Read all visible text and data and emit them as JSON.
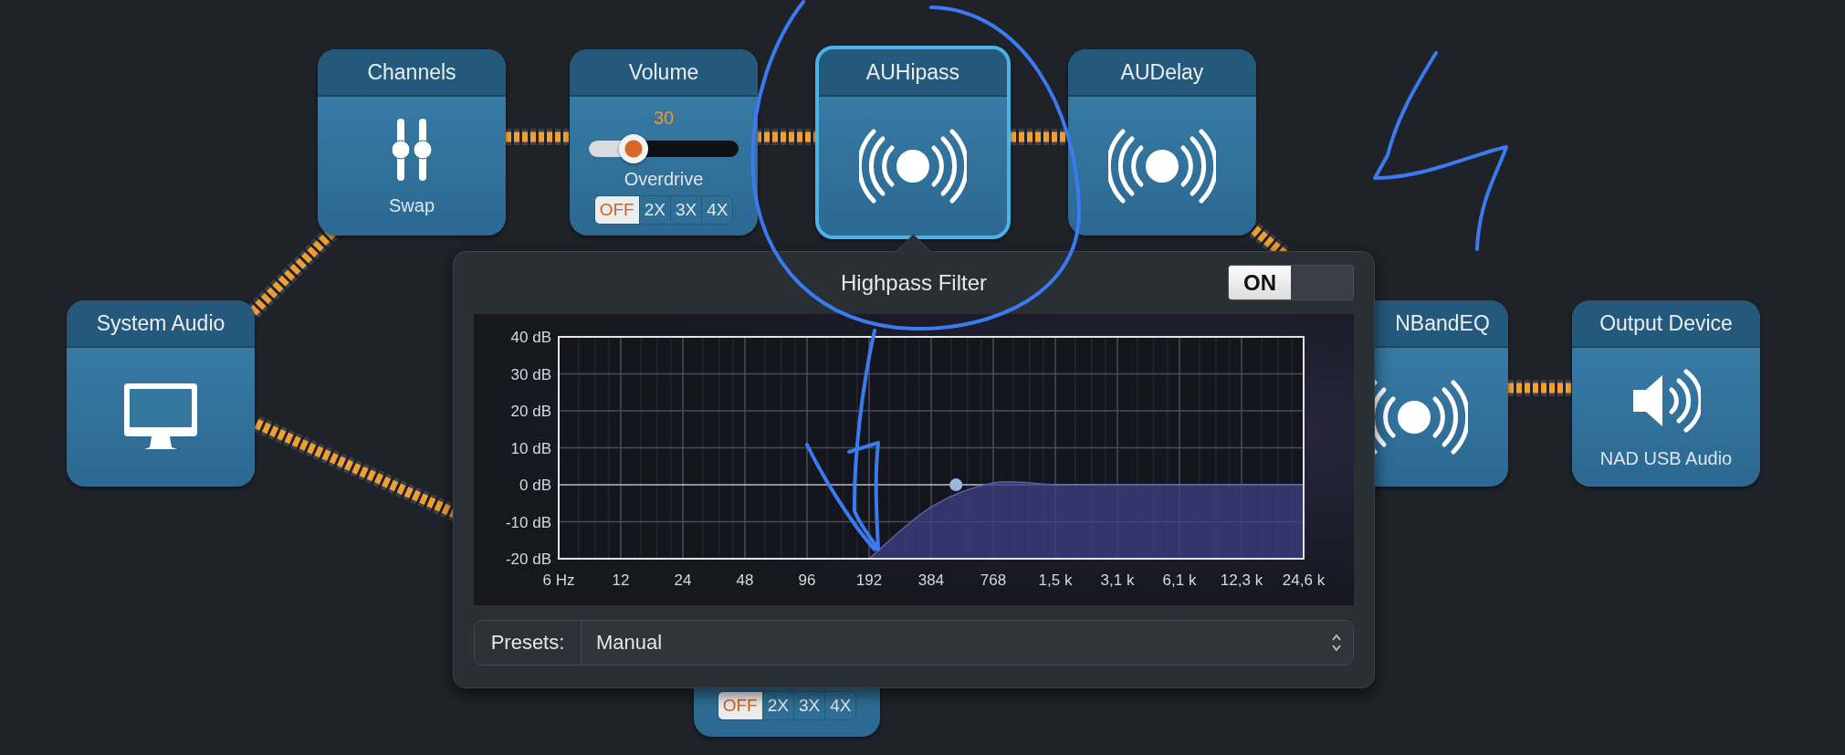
{
  "blocks": [
    {
      "kind": "channels",
      "title": "Channels",
      "caption": "Swap",
      "selected": false
    },
    {
      "kind": "volume",
      "title": "Volume",
      "value": "30",
      "level": 0.3,
      "sublabel": "Overdrive",
      "selected": false,
      "options": [
        {
          "label": "OFF",
          "selected": true
        },
        {
          "label": "2X",
          "selected": false
        },
        {
          "label": "3X",
          "selected": false
        },
        {
          "label": "4X",
          "selected": false
        }
      ]
    },
    {
      "kind": "effect",
      "title": "AUHipass",
      "selected": true
    },
    {
      "kind": "effect",
      "title": "AUDelay",
      "selected": false
    },
    {
      "kind": "source",
      "title": "System Audio",
      "selected": false
    },
    {
      "kind": "effect",
      "title": "NBandEQ",
      "selected": false
    },
    {
      "kind": "output",
      "title": "Output Device",
      "caption": "NAD USB Audio",
      "selected": false
    },
    {
      "kind": "overdrive",
      "selected": false,
      "options": [
        {
          "label": "OFF",
          "selected": true
        },
        {
          "label": "2X",
          "selected": false
        },
        {
          "label": "3X",
          "selected": false
        },
        {
          "label": "4X",
          "selected": false
        }
      ]
    }
  ],
  "popover": {
    "title": "Highpass Filter",
    "switch": {
      "label": "ON",
      "on": true
    },
    "chart_data": {
      "type": "area",
      "categories": [
        "6 Hz",
        "12",
        "24",
        "48",
        "96",
        "192",
        "384",
        "768",
        "1,5 k",
        "3,1 k",
        "6,1 k",
        "12,3 k",
        "24,6 k"
      ],
      "values": [
        null,
        null,
        null,
        null,
        null,
        -20,
        -6,
        0.5,
        0,
        0,
        0,
        0,
        0
      ],
      "ylim": [
        -20,
        40
      ],
      "yticks": [
        {
          "value": 40,
          "label": "40 dB"
        },
        {
          "value": 30,
          "label": "30 dB"
        },
        {
          "value": 20,
          "label": "20 dB"
        },
        {
          "value": 10,
          "label": "10 dB"
        },
        {
          "value": 0,
          "label": "0 dB"
        },
        {
          "value": -10,
          "label": "-10 dB"
        },
        {
          "value": -20,
          "label": "-20 dB"
        }
      ],
      "grid": true
    },
    "presets": {
      "label": "Presets:",
      "value": "Manual"
    }
  }
}
